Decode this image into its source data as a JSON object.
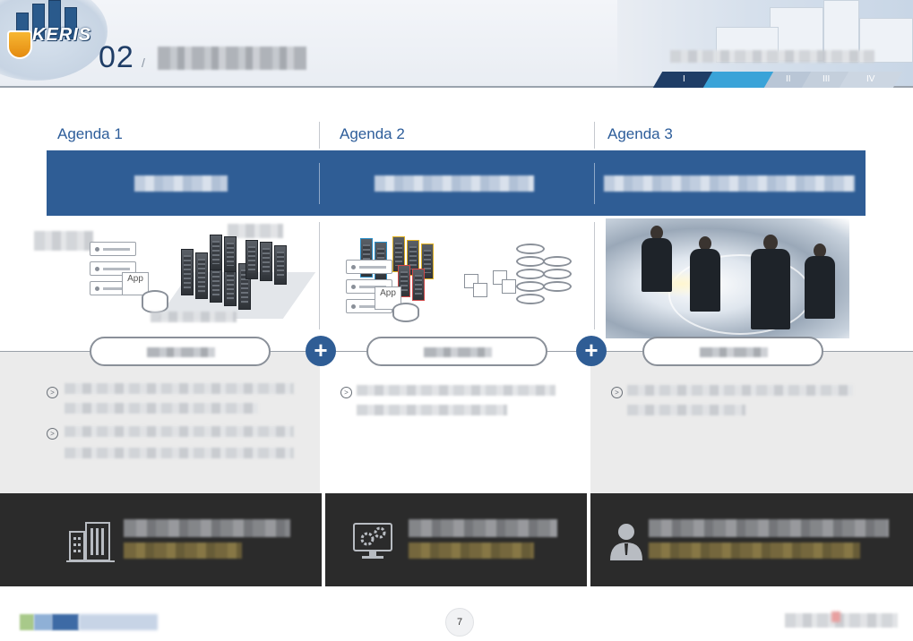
{
  "header": {
    "logo_text": "KERIS",
    "section_number": "02",
    "section_slash": "/",
    "roman_tabs": [
      "I",
      "II",
      "III",
      "IV"
    ]
  },
  "agendas": [
    {
      "label": "Agenda 1"
    },
    {
      "label": "Agenda 2"
    },
    {
      "label": "Agenda 3"
    }
  ],
  "illustrations": {
    "app_label_1": "App",
    "app_label_2": "App"
  },
  "plus_signs": [
    "+",
    "+"
  ],
  "icons": [
    "building-icon",
    "monitor-gear-icon",
    "person-icon"
  ],
  "footer": {
    "page_number": "7"
  },
  "colors": {
    "accent_blue": "#2f5d95",
    "agenda_text": "#2d5d9a",
    "dark_band": "#2b2b2b"
  }
}
